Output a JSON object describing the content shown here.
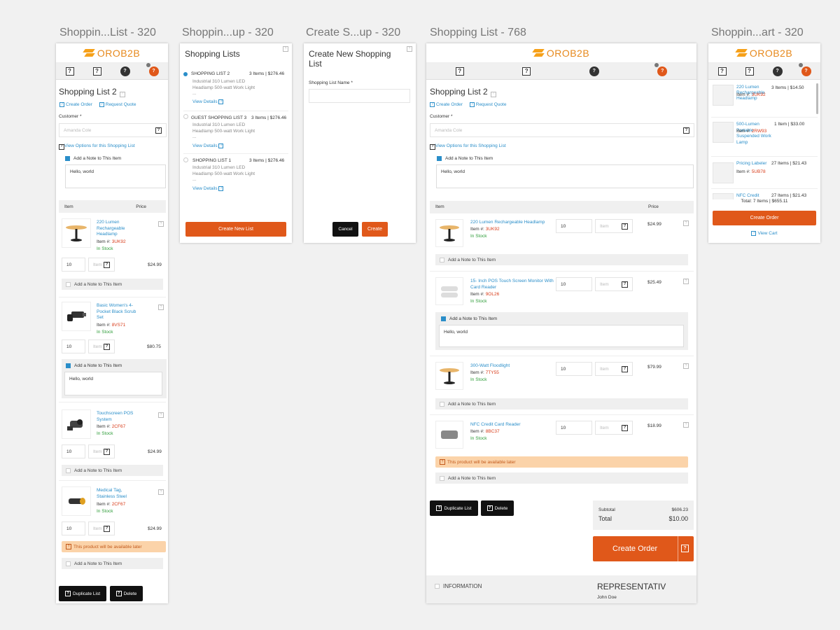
{
  "artboards": {
    "a1": "Shoppin...List - 320",
    "a2": "Shoppin...up - 320",
    "a3": "Create S...up - 320",
    "a4": "Shopping List - 768",
    "a5": "Shoppin...art - 320"
  },
  "logo": "OROB2B",
  "brand_color": "#e0581a",
  "common": {
    "qmark": "?",
    "create_order": "Create Order",
    "request_quote": "Request Quote",
    "customer_label": "Customer *",
    "customer_placeholder": "Amanda Cole",
    "view_options": "View Options for this Shopping List",
    "add_note": "Add a Note to This Item",
    "note_text": "Hello, world",
    "item_col": "Item",
    "price_col": "Price",
    "item_no": "Item #:",
    "in_stock": "In Stock",
    "unit_ph": "Item",
    "avail_later": "This product will be available later",
    "duplicate": "Duplicate List",
    "delete": "Delete"
  },
  "list320": {
    "title": "Shopping List 2",
    "products": [
      {
        "name": "220 Lumen Rechargeable Headlamp",
        "sku": "3UK92",
        "qty": "10",
        "price": "$24.99"
      },
      {
        "name": "Basic Women's 4-Pocket Black Scrub Set",
        "sku": "8VS71",
        "qty": "10",
        "price": "$80.75"
      },
      {
        "name": "Touchscreen POS System",
        "sku": "2CF67",
        "qty": "10",
        "price": "$24.99"
      },
      {
        "name": "Medical Tag, Stainless Steel",
        "sku": "2CF67",
        "qty": "10",
        "price": "$24.99"
      }
    ]
  },
  "popup": {
    "title": "Shopping Lists",
    "lists": [
      {
        "name": "SHOPPING LIST 2",
        "summary": "3 Items | $276.46",
        "line1": "Industrial 310 Lumen LED",
        "line2": "Headlamp 500-watt Work Light",
        "more": "...",
        "details": "View Details"
      },
      {
        "name": "GUEST SHOPPING LIST 3",
        "summary": "3 Items | $276.46",
        "line1": "Industrial 310 Lumen LED",
        "line2": "Headlamp 500-watt Work Light",
        "more": "...",
        "details": "View Details"
      },
      {
        "name": "SHOPPING LIST 1",
        "summary": "3 Items | $276.46",
        "line1": "Industrial 310 Lumen LED",
        "line2": "Headlamp 500-watt Work Light",
        "more": "...",
        "details": "View Details"
      }
    ],
    "create_btn": "Create New List"
  },
  "create": {
    "title": "Create New Shopping List",
    "name_label": "Shopping List Name *",
    "cancel": "Cancel",
    "create": "Create"
  },
  "list768": {
    "title": "Shopping List 2",
    "products": [
      {
        "name": "220 Lumen Rechargeable Headlamp",
        "sku": "3UK92",
        "qty": "10",
        "price": "$24.99"
      },
      {
        "name": "15- Inch POS Touch Screen Monitor With Card Reader",
        "sku": "9OL26",
        "qty": "10",
        "price": "$25.49"
      },
      {
        "name": "300-Watt Floodlight",
        "sku": "7TY55",
        "qty": "10",
        "price": "$79.99"
      },
      {
        "name": "NFC Credit Card Reader",
        "sku": "8BC37",
        "qty": "10",
        "price": "$18.99"
      }
    ],
    "subtotal_label": "Subtotal",
    "subtotal": "$606.23",
    "total_label": "Total",
    "total": "$10.00",
    "create_order_big": "Create Order",
    "information": "INFORMATION",
    "representative": "REPRESENTATIV",
    "rep_name": "John Doe"
  },
  "cart": {
    "items": [
      {
        "name": "220 Lumen Rechargeable Headlamp",
        "summary": "3 Items | $14.50",
        "sku": "3UK92"
      },
      {
        "name": "500-Lumen Portable Suspended Work Lamp",
        "summary": "1 Item | $33.00",
        "sku": "2RW93"
      },
      {
        "name": "Pricing Labeler",
        "summary": "27 Items | $21.43",
        "sku": "5UB78"
      },
      {
        "name": "NFC Credit",
        "summary": "27 Items | $21.43",
        "sku": ""
      }
    ],
    "total": "Total: 7 Items | $655.11",
    "create_order": "Create Order",
    "view_cart": "View Cart"
  }
}
